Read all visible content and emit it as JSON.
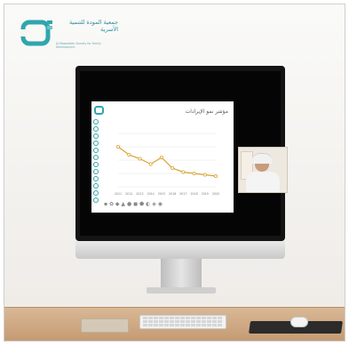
{
  "logo": {
    "name_ar": "جمعية المودة للتنمية الأسرية",
    "name_en": "Al-Mawaddah Society for Family Development"
  },
  "slide": {
    "title": "مؤشر نمو الإيرادات"
  },
  "colors": {
    "brand_teal": "#2fa6ae",
    "chart_line": "#d9a431",
    "shelf": "#c49a72"
  },
  "chart_data": {
    "type": "line",
    "title": "",
    "xlabel": "",
    "ylabel": "",
    "categories": [
      "2011",
      "2012",
      "2013",
      "2014",
      "2015",
      "2016",
      "2017",
      "2018",
      "2019",
      "2020"
    ],
    "series": [
      {
        "values": [
          3.0,
          2.4,
          2.1,
          1.7,
          2.2,
          1.4,
          1.1,
          1.0,
          0.9,
          0.8
        ]
      }
    ],
    "ylim": [
      0,
      4
    ],
    "grid": true
  }
}
